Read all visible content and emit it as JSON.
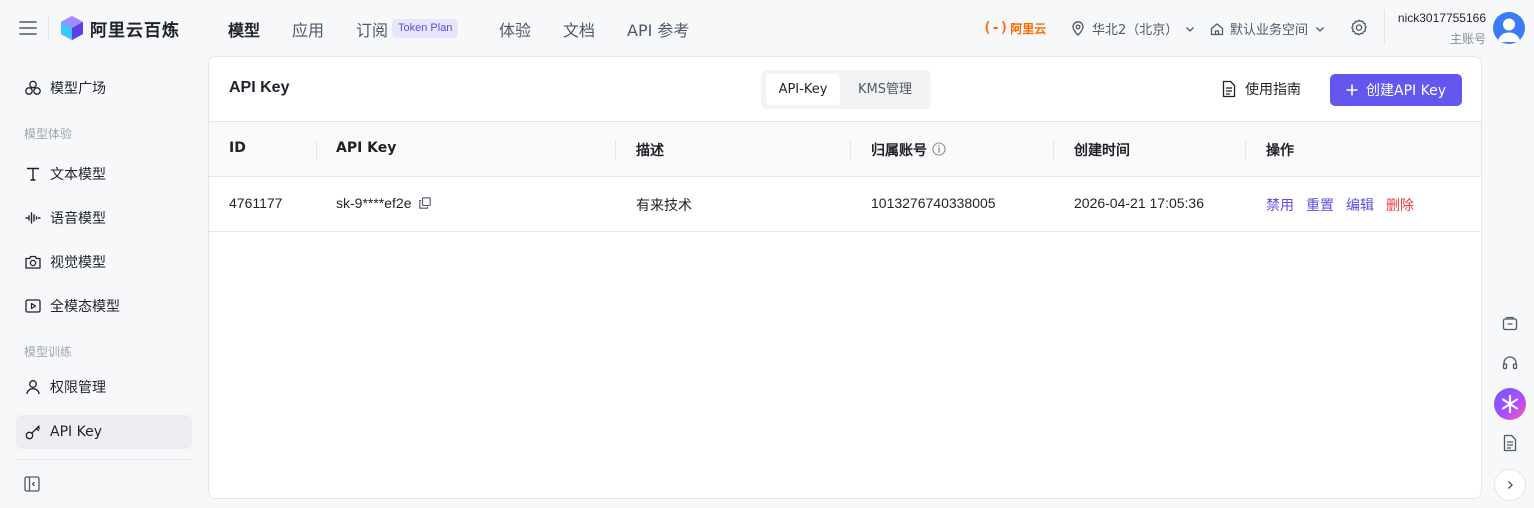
{
  "header": {
    "brand": "阿里云百炼",
    "nav": [
      {
        "label": "模型",
        "active": true
      },
      {
        "label": "应用",
        "active": false
      },
      {
        "label": "订阅",
        "active": false
      },
      {
        "label": "体验",
        "active": false
      },
      {
        "label": "文档",
        "active": false
      },
      {
        "label": "API 参考",
        "active": false
      }
    ],
    "subscribe_badge": "Token Plan",
    "aliyun_logo_text": "阿里云",
    "region": "华北2（北京）",
    "workspace": "默认业务空间",
    "user_name": "nick3017755166",
    "user_role": "主账号"
  },
  "sidebar": {
    "items": [
      {
        "label": "模型广场",
        "icon": "model-square-icon"
      },
      {
        "label": "文本模型",
        "icon": "text-model-icon"
      },
      {
        "label": "语音模型",
        "icon": "audio-wave-icon"
      },
      {
        "label": "视觉模型",
        "icon": "camera-icon"
      },
      {
        "label": "全模态模型",
        "icon": "video-play-icon"
      },
      {
        "label": "权限管理",
        "icon": "user-icon"
      },
      {
        "label": "API Key",
        "icon": "key-icon",
        "active": true
      }
    ],
    "groups": [
      "模型体验",
      "模型训练"
    ]
  },
  "main": {
    "title": "API Key",
    "tabs": [
      {
        "label": "API-Key",
        "active": true
      },
      {
        "label": "KMS管理",
        "active": false
      }
    ],
    "guide_label": "使用指南",
    "create_label": "创建API Key",
    "table": {
      "columns": [
        "ID",
        "API Key",
        "描述",
        "归属账号",
        "创建时间",
        "操作"
      ],
      "rows": [
        {
          "id": "4761177",
          "api_key": "sk-9****ef2e",
          "desc": "有来技术",
          "account": "1013276740338005",
          "created": "2026-04-21 17:05:36",
          "actions": [
            "禁用",
            "重置",
            "编辑",
            "删除"
          ]
        }
      ]
    }
  },
  "colors": {
    "accent": "#6457f0",
    "link": "#5b4fe0",
    "danger": "#f23c3c",
    "aliyun_orange": "#ff6a00"
  }
}
